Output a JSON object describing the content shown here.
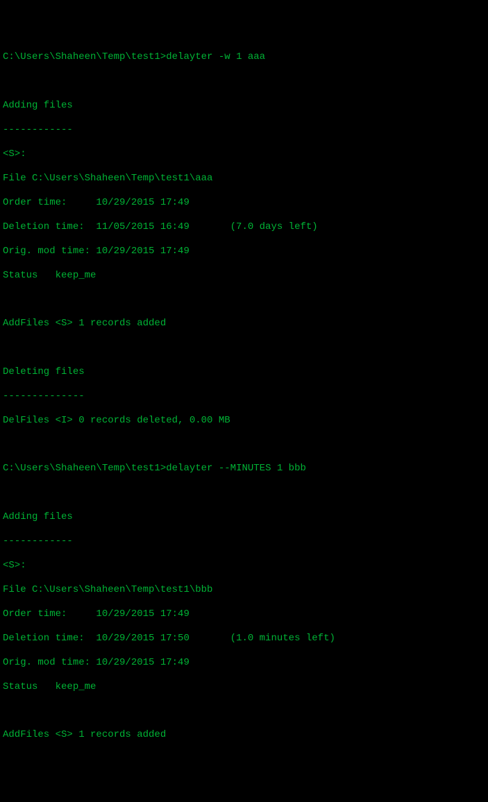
{
  "session1": {
    "prompt_path": "C:\\Users\\Shaheen\\Temp\\test1>",
    "prompt_command": "delayter -w 1 aaa",
    "blank1": "",
    "adding_header": "Adding files",
    "adding_underline": "------------",
    "s_header": "<S>:",
    "file_line": "File C:\\Users\\Shaheen\\Temp\\test1\\aaa",
    "order_time": "Order time:     10/29/2015 17:49",
    "deletion_time": "Deletion time:  11/05/2015 16:49       (7.0 days left)",
    "orig_mod_time": "Orig. mod time: 10/29/2015 17:49",
    "status_line": "Status   keep_me",
    "blank2": "",
    "addfiles_result": "AddFiles <S> 1 records added",
    "blank3": "",
    "deleting_header": "Deleting files",
    "deleting_underline": "--------------",
    "delfiles_result": "DelFiles <I> 0 records deleted, 0.00 MB",
    "blank4": ""
  },
  "session2": {
    "prompt_path": "C:\\Users\\Shaheen\\Temp\\test1>",
    "prompt_command": "delayter --MINUTES 1 bbb",
    "blank1": "",
    "adding_header": "Adding files",
    "adding_underline": "------------",
    "s_header": "<S>:",
    "file_line": "File C:\\Users\\Shaheen\\Temp\\test1\\bbb",
    "order_time": "Order time:     10/29/2015 17:49",
    "deletion_time": "Deletion time:  10/29/2015 17:50       (1.0 minutes left)",
    "orig_mod_time": "Orig. mod time: 10/29/2015 17:49",
    "status_line": "Status   keep_me",
    "blank2": "",
    "addfiles_result": "AddFiles <S> 1 records added"
  }
}
